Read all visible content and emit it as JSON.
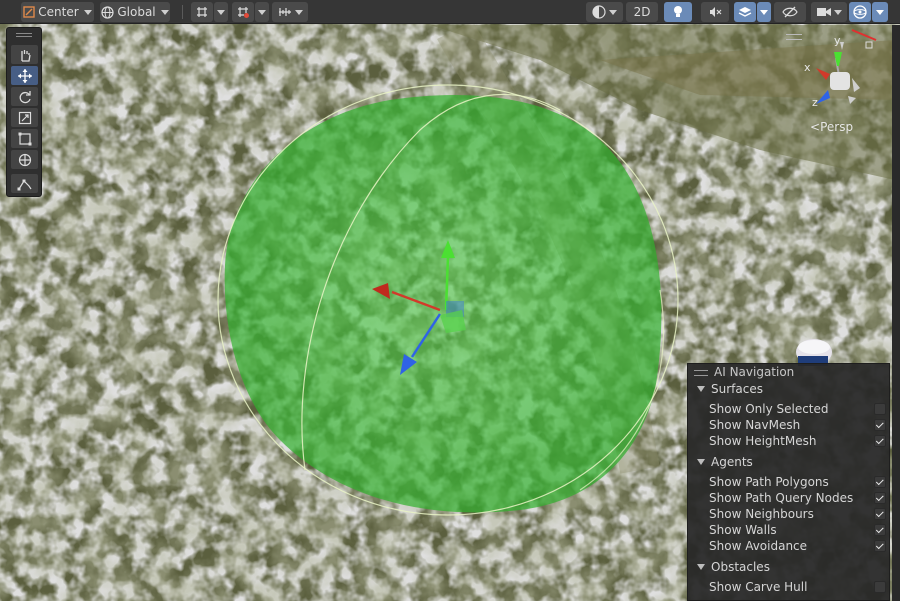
{
  "toolbar": {
    "pivot_label": "Center",
    "space_label": "Global",
    "mode_2d_label": "2D"
  },
  "tools": [
    "hand-tool",
    "move-tool",
    "rotate-tool",
    "scale-tool",
    "rect-tool",
    "transform-tool",
    "custom-tool"
  ],
  "gizmo": {
    "axis_y": "y",
    "axis_x": "x",
    "axis_z": "z",
    "projection_label": "Persp"
  },
  "ai_navigation": {
    "title": "AI Navigation",
    "sections": [
      {
        "label": "Surfaces",
        "options": [
          {
            "label": "Show Only Selected",
            "checked": false
          },
          {
            "label": "Show NavMesh",
            "checked": true
          },
          {
            "label": "Show HeightMesh",
            "checked": true
          }
        ]
      },
      {
        "label": "Agents",
        "options": [
          {
            "label": "Show Path Polygons",
            "checked": true
          },
          {
            "label": "Show Path Query Nodes",
            "checked": true
          },
          {
            "label": "Show Neighbours",
            "checked": true
          },
          {
            "label": "Show Walls",
            "checked": true
          },
          {
            "label": "Show Avoidance",
            "checked": true
          }
        ]
      },
      {
        "label": "Obstacles",
        "options": [
          {
            "label": "Show Carve Hull",
            "checked": false
          }
        ]
      }
    ]
  },
  "colors": {
    "navmesh_green": "#3cc83c",
    "axis_x": "#d23a2a",
    "axis_y": "#4be032",
    "axis_z": "#2f63e6",
    "active_tool": "#475e85"
  }
}
